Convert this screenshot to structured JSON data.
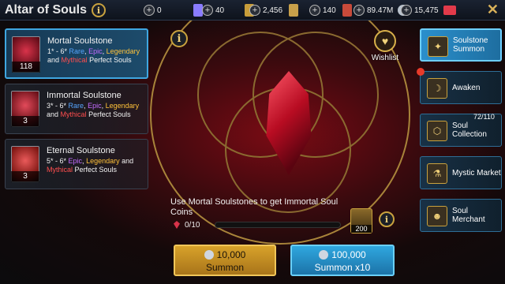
{
  "header": {
    "title": "Altar of Souls",
    "info_label": "i",
    "close_label": "✕"
  },
  "resources": [
    {
      "name": "resource-1",
      "value": "0",
      "color": "#8a7cff"
    },
    {
      "name": "resource-2",
      "value": "40",
      "color": "#c89d3a"
    },
    {
      "name": "resource-3",
      "value": "2,456",
      "color": "#c8a04a"
    },
    {
      "name": "resource-4",
      "value": "140",
      "color": "#c84a3a"
    },
    {
      "name": "resource-5",
      "value": "89.47M",
      "color": "#b9c2cc"
    },
    {
      "name": "resource-6",
      "value": "15,475",
      "color": "#e23a4a"
    }
  ],
  "soulstones": [
    {
      "name": "Mortal Soulstone",
      "count": "118",
      "desc_prefix": "1* - 6*",
      "rare": "Rare",
      "epic": "Epic",
      "legendary": "Legendary",
      "and": "and",
      "mythical": "Mythical",
      "suffix": "Perfect Souls"
    },
    {
      "name": "Immortal Soulstone",
      "count": "3",
      "desc_prefix": "3* - 6*",
      "rare": "Rare",
      "epic": "Epic",
      "legendary": "Legendary",
      "and": "and",
      "mythical": "Mythical",
      "suffix": "Perfect Souls"
    },
    {
      "name": "Eternal Soulstone",
      "count": "3",
      "desc_prefix": "5* - 6*",
      "epic": "Epic",
      "legendary": "Legendary",
      "and": "and",
      "mythical": "Mythical",
      "suffix": "Perfect Souls"
    }
  ],
  "center": {
    "info_label": "i",
    "wishlist_label": "Wishlist",
    "hint": "Use Mortal Soulstones to get Immortal Soul Coins",
    "progress_text": "0/10",
    "progress_fraction": 0,
    "coin_count": "200",
    "hint_info_label": "i"
  },
  "buttons": {
    "summon_cost": "10,000",
    "summon_label": "Summon",
    "summon10_cost": "100,000",
    "summon10_label": "Summon x10"
  },
  "menu": {
    "items": [
      {
        "label": "Soulstone Summon",
        "icon": "summon-icon"
      },
      {
        "label": "Awaken",
        "icon": "awaken-icon"
      },
      {
        "label": "Soul Collection",
        "icon": "collection-icon"
      },
      {
        "label": "Mystic Market",
        "icon": "market-icon"
      },
      {
        "label": "Soul Merchant",
        "icon": "merchant-icon"
      }
    ],
    "collection_badge": "72/110"
  }
}
